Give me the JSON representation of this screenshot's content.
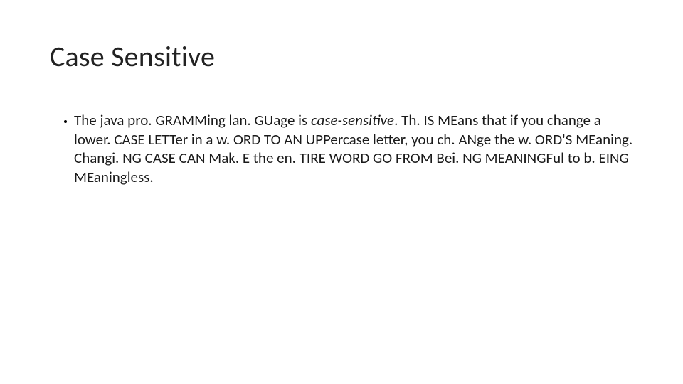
{
  "slide": {
    "title": "Case Sensitive",
    "bullets": [
      {
        "seg1": "The java pro. GRAMMing lan. GUage is ",
        "italic": "case-sensitive",
        "seg2": ". Th. IS MEans that if you change a lower. CASE LETTer in a w. ORD TO AN UPPercase letter, you ch. ANge the w. ORD'S MEaning. Changi. NG CASE CAN Mak. E the en. TIRE WORD GO FROM Bei. NG MEANINGFul to b. EING MEaningless."
      }
    ]
  }
}
